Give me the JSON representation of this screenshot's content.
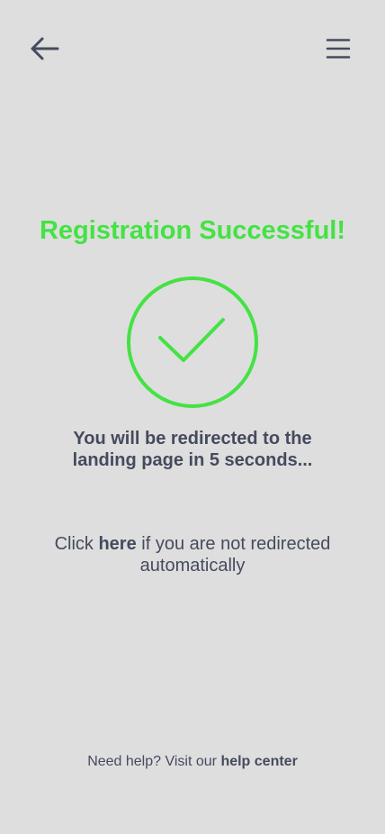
{
  "colors": {
    "background": "#dedede",
    "success": "#44e244",
    "text": "#454b5e"
  },
  "header": {
    "back_icon": "arrow-left-icon",
    "menu_icon": "hamburger-menu-icon"
  },
  "main": {
    "title": "Registration Successful!",
    "status_icon": "checkmark-circle-icon",
    "redirect_line1": "You will be redirected to the",
    "redirect_line2": "landing page in 5 seconds...",
    "manual_prefix": "Click ",
    "manual_link": "here",
    "manual_suffix": " if you are not redirected automatically"
  },
  "footer": {
    "help_prefix": "Need help? Visit our ",
    "help_link": "help center"
  }
}
